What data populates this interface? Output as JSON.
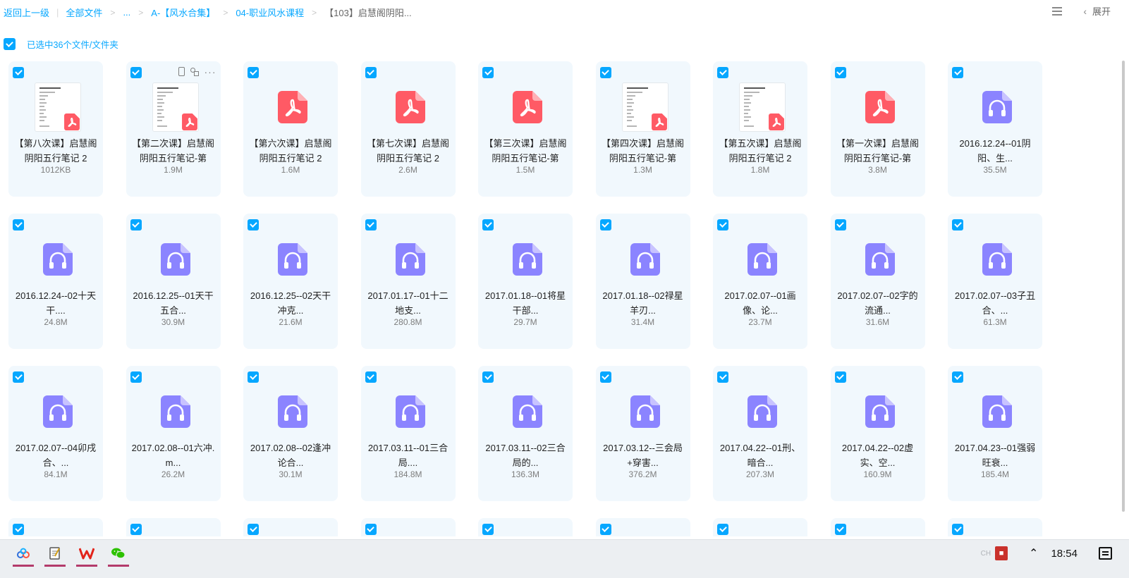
{
  "breadcrumb": {
    "back": "返回上一级",
    "items": [
      "全部文件",
      "...",
      "A-【风水合集】",
      "04-职业风水课程",
      "【103】启慧阁阴阳..."
    ]
  },
  "top_right": {
    "expand_label": "展开"
  },
  "selection": {
    "text": "已选中36个文件/文件夹"
  },
  "files": [
    {
      "name": "【第八次课】启慧阁阴阳五行笔记 2",
      "size": "1012KB",
      "type": "pdf-thumb"
    },
    {
      "name": "【第二次课】启慧阁阴阳五行笔记-第",
      "size": "1.9M",
      "type": "pdf-thumb",
      "hover": true
    },
    {
      "name": "【第六次课】启慧阁阴阳五行笔记 2",
      "size": "1.6M",
      "type": "pdf"
    },
    {
      "name": "【第七次课】启慧阁阴阳五行笔记 2",
      "size": "2.6M",
      "type": "pdf"
    },
    {
      "name": "【第三次课】启慧阁阴阳五行笔记-第",
      "size": "1.5M",
      "type": "pdf"
    },
    {
      "name": "【第四次课】启慧阁阴阳五行笔记-第",
      "size": "1.3M",
      "type": "pdf-thumb"
    },
    {
      "name": "【第五次课】启慧阁阴阳五行笔记 2",
      "size": "1.8M",
      "type": "pdf-thumb"
    },
    {
      "name": "【第一次课】启慧阁阴阳五行笔记-第",
      "size": "3.8M",
      "type": "pdf"
    },
    {
      "name": "2016.12.24--01阴阳、生...",
      "size": "35.5M",
      "type": "audio"
    },
    {
      "name": "2016.12.24--02十天干....",
      "size": "24.8M",
      "type": "audio"
    },
    {
      "name": "2016.12.25--01天干五合...",
      "size": "30.9M",
      "type": "audio"
    },
    {
      "name": "2016.12.25--02天干冲克...",
      "size": "21.6M",
      "type": "audio"
    },
    {
      "name": "2017.01.17--01十二地支...",
      "size": "280.8M",
      "type": "audio"
    },
    {
      "name": "2017.01.18--01将星干部...",
      "size": "29.7M",
      "type": "audio"
    },
    {
      "name": "2017.01.18--02禄星羊刃...",
      "size": "31.4M",
      "type": "audio"
    },
    {
      "name": "2017.02.07--01画像、论...",
      "size": "23.7M",
      "type": "audio"
    },
    {
      "name": "2017.02.07--02字的流通...",
      "size": "31.6M",
      "type": "audio"
    },
    {
      "name": "2017.02.07--03子丑合、...",
      "size": "61.3M",
      "type": "audio"
    },
    {
      "name": "2017.02.07--04卯戌合、...",
      "size": "84.1M",
      "type": "audio"
    },
    {
      "name": "2017.02.08--01六冲.m...",
      "size": "26.2M",
      "type": "audio"
    },
    {
      "name": "2017.02.08--02逢冲论合...",
      "size": "30.1M",
      "type": "audio"
    },
    {
      "name": "2017.03.11--01三合局....",
      "size": "184.8M",
      "type": "audio"
    },
    {
      "name": "2017.03.11--02三合局的...",
      "size": "136.3M",
      "type": "audio"
    },
    {
      "name": "2017.03.12--三会局+穿害...",
      "size": "376.2M",
      "type": "audio"
    },
    {
      "name": "2017.04.22--01刑、暗合...",
      "size": "207.3M",
      "type": "audio"
    },
    {
      "name": "2017.04.22--02虚实、空...",
      "size": "160.9M",
      "type": "audio"
    },
    {
      "name": "2017.04.23--01强弱旺衰...",
      "size": "185.4M",
      "type": "audio"
    }
  ],
  "partial_row_count": 9,
  "taskbar": {
    "apps": [
      "baidu-netdisk",
      "notepad",
      "wps-office",
      "wechat"
    ],
    "tray_lang": "CH",
    "clock": "18:54"
  },
  "colors": {
    "accent": "#06a7ff",
    "pdf": "#ff5a65",
    "audio": "#8b84ff",
    "tile_bg": "#f1f8fd"
  }
}
